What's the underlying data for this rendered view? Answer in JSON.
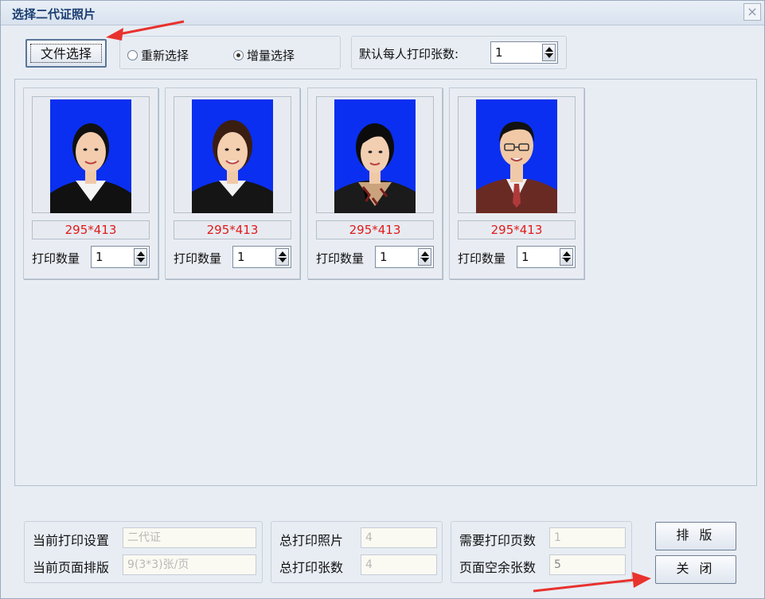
{
  "window": {
    "title": "选择二代证照片",
    "close_icon": "×"
  },
  "toolbar": {
    "file_button": "文件选择",
    "radio_reselect": "重新选择",
    "radio_incremental": "增量选择",
    "selected_mode": "incremental",
    "default_prints_label": "默认每人打印张数:",
    "default_prints_value": "1"
  },
  "photos": [
    {
      "size": "295*413",
      "qty_label": "打印数量",
      "qty": "1"
    },
    {
      "size": "295*413",
      "qty_label": "打印数量",
      "qty": "1"
    },
    {
      "size": "295*413",
      "qty_label": "打印数量",
      "qty": "1"
    },
    {
      "size": "295*413",
      "qty_label": "打印数量",
      "qty": "1"
    }
  ],
  "footer": {
    "current_print_setting_label": "当前打印设置",
    "current_print_setting_value": "二代证",
    "current_layout_label": "当前页面排版",
    "current_layout_value": "9(3*3)张/页",
    "total_photos_label": "总打印照片",
    "total_photos_value": "4",
    "total_sheets_label": "总打印张数",
    "total_sheets_value": "4",
    "pages_needed_label": "需要打印页数",
    "pages_needed_value": "1",
    "page_empty_label": "页面空余张数",
    "page_empty_value": "5",
    "layout_button": "排 版",
    "close_button": "关 闭"
  },
  "colors": {
    "photo_background": "#0a2ff0",
    "size_text": "#e01a1a",
    "annotation_arrow": "#e8322d"
  }
}
